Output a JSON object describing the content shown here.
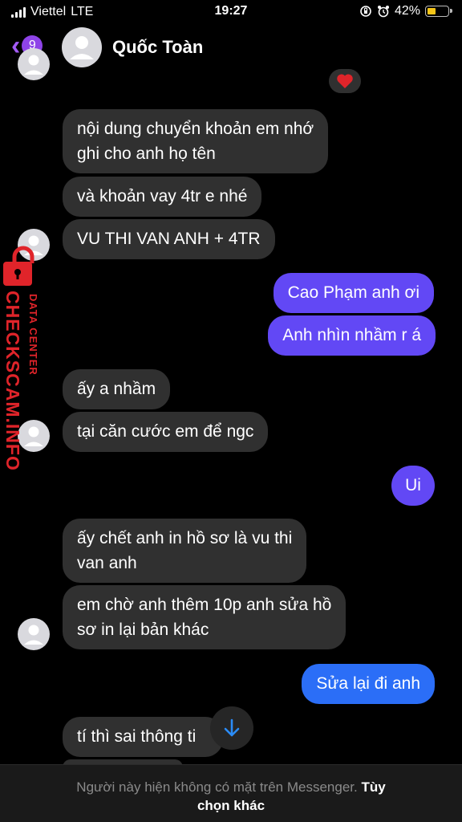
{
  "status_bar": {
    "carrier": "Viettel",
    "network": "LTE",
    "time": "19:27",
    "battery": "42%"
  },
  "header": {
    "back_count": "9",
    "contact_name": "Quốc Toàn"
  },
  "watermark": {
    "brand": "CHECKSCAM.INFO",
    "sub": "DATA CENTER"
  },
  "messages": [
    {
      "from": "them",
      "text_lines": [
        "nội dung chuyển khoản em nhớ",
        "ghi cho anh họ tên"
      ]
    },
    {
      "from": "them",
      "text_lines": [
        "và khoản vay 4tr e nhé"
      ]
    },
    {
      "from": "them",
      "text_lines": [
        "VU THI VAN ANH + 4TR"
      ]
    },
    {
      "from": "me",
      "text_lines": [
        "Cao Phạm anh ơi"
      ]
    },
    {
      "from": "me",
      "text_lines": [
        "Anh nhìn nhầm r á"
      ]
    },
    {
      "from": "them",
      "text_lines": [
        "ấy a nhầm"
      ]
    },
    {
      "from": "them",
      "text_lines": [
        "tại căn cước em để ngc"
      ]
    },
    {
      "from": "me",
      "text_lines": [
        "Ui"
      ]
    },
    {
      "from": "them",
      "text_lines": [
        "ấy chết anh in hồ sơ là vu thi",
        "van anh"
      ]
    },
    {
      "from": "them",
      "text_lines": [
        "em chờ anh thêm 10p anh sửa hồ",
        "sơ in lại bản khác"
      ]
    },
    {
      "from": "me",
      "text_lines": [
        "Sửa lại đi anh"
      ]
    },
    {
      "from": "them",
      "text_lines": [
        "tí thì sai thông ti"
      ]
    }
  ],
  "footer": {
    "notice": "Người này hiện không có mặt trên Messenger.",
    "option_part1": "Tùy",
    "option_part2": "chọn khác"
  },
  "colors": {
    "incoming": "#303030",
    "outgoing": "#6248f5",
    "outgoing_last": "#2b6ef7",
    "accent": "#a35bf6",
    "watermark": "#e0242a"
  },
  "icons": [
    "back-chevron-icon",
    "signal-icon",
    "orientation-lock-icon",
    "alarm-icon",
    "battery-icon",
    "heart-reaction-icon",
    "scroll-down-arrow-icon",
    "avatar-icon",
    "lock-icon"
  ]
}
